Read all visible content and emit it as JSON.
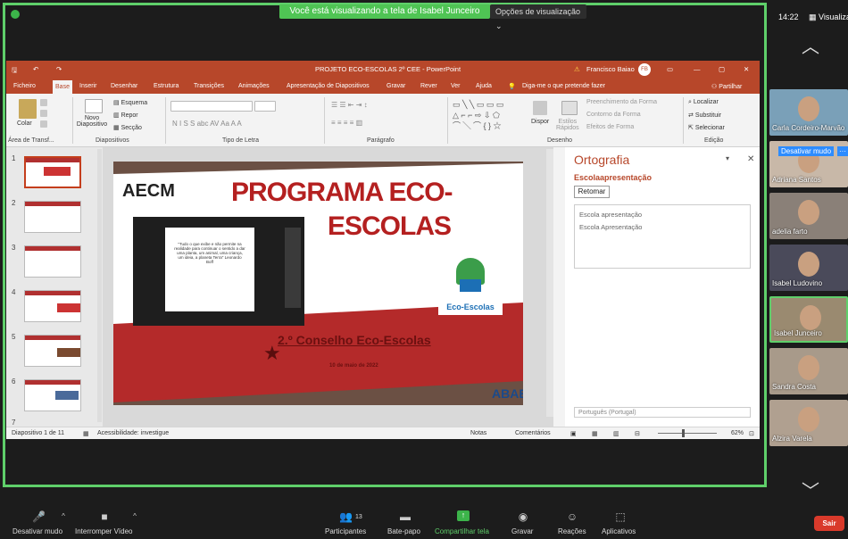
{
  "zoom": {
    "share_banner": "Você está visualizando a tela de Isabel Junceiro",
    "view_options": "Opções de visualização ⌄",
    "time": "14:22",
    "view_menu": "Visualiza",
    "bottom": {
      "mute": "Desativar mudo",
      "stop_video": "Interromper Vídeo",
      "participants": "Participantes",
      "participants_count": "13",
      "chat": "Bate-papo",
      "share": "Compartilhar tela",
      "record": "Gravar",
      "reactions": "Reações",
      "apps": "Aplicativos",
      "leave": "Sair"
    }
  },
  "powerpoint": {
    "title": "PROJETO ECO-ESCOLAS 2º CEE  -  PowerPoint",
    "warning": "Francisco Baiao",
    "user_initials": "FB",
    "menu": [
      "Ficheiro",
      "Base",
      "Inserir",
      "Desenhar",
      "Estrutura",
      "Transições",
      "Animações",
      "Apresentação de Diapositivos",
      "Gravar",
      "Rever",
      "Ver",
      "Ajuda"
    ],
    "tell_me": "Diga-me o que pretende fazer",
    "share": "Partilhar",
    "ribbon": {
      "paste": "Colar",
      "new_slide": "Novo\nDiapositivo",
      "layout": "Esquema",
      "reset": "Repor",
      "section": "Secção",
      "clipboard": "Área de Transf...",
      "slides": "Diapositivos",
      "font": "Tipo de Letra",
      "paragraph": "Parágrafo",
      "drawing": "Desenho",
      "editing": "Edição",
      "arrange": "Dispor",
      "quick_styles": "Estilos\nRápidos",
      "shape_fill": "Preenchimento da Forma",
      "shape_outline": "Contorno da Forma",
      "shape_effects": "Efeitos de Forma",
      "find": "Localizar",
      "replace": "Substituir",
      "select": "Selecionar"
    },
    "thumb_numbers": [
      "1",
      "2",
      "3",
      "4",
      "5",
      "6",
      "7"
    ],
    "slide": {
      "title_line1": "PROGRAMA ECO-",
      "title_line2": "ESCOLAS",
      "logo": "AECM",
      "eco_label": "Eco-Escolas",
      "subtitle": "2.º Conselho Eco-Escolas",
      "date": "10 de maio de 2022",
      "abae": "ABAE",
      "embed_quote": "\"Tudo o que exibe e não permite na realidade para continuar o sentido a dar uma planta, um animal, uma criança, um ideia, a planeta Terra\" Leonardo Boff"
    },
    "spelling": {
      "title": "Ortografia",
      "word": "Escolaapresentação",
      "resume": "Retomar",
      "suggestions": [
        "Escola apresentação",
        "Escola Apresentação"
      ],
      "language": "Português (Portugal)"
    },
    "status": {
      "slide": "Diapositivo 1 de 11",
      "accessibility": "Acessibilidade: investigue",
      "notes": "Notas",
      "comments": "Comentários",
      "zoom": "62%"
    }
  },
  "participants": [
    {
      "name": "Carla Cordeiro-Marvão"
    },
    {
      "name": "Adriana Santos",
      "overlay": "Desativar mudo"
    },
    {
      "name": "adelia farto"
    },
    {
      "name": "Isabel Ludovino"
    },
    {
      "name": "Isabel Junceiro"
    },
    {
      "name": "Sandra Costa"
    },
    {
      "name": "Alzira Varela"
    }
  ]
}
